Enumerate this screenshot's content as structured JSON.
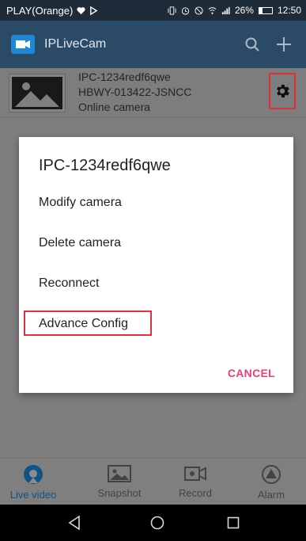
{
  "status_bar": {
    "carrier": "PLAY(Orange)",
    "signal_battery": "26%",
    "battery_level": 0.26,
    "time": "12:50"
  },
  "app_bar": {
    "title": "IPLiveCam",
    "icons": [
      "camera-logo-icon",
      "search-icon",
      "plus-icon"
    ]
  },
  "camera": {
    "name": "IPC-1234redf6qwe",
    "uid": "HBWY-013422-JSNCC",
    "status": "Online camera"
  },
  "dialog": {
    "title": "IPC-1234redf6qwe",
    "items": [
      "Modify camera",
      "Delete camera",
      "Reconnect",
      "Advance Config"
    ],
    "cancel": "CANCEL"
  },
  "bottom_nav": {
    "tabs": [
      {
        "label": "Live video",
        "icon": "live-video-icon",
        "active": true
      },
      {
        "label": "Snapshot",
        "icon": "snapshot-icon",
        "active": false
      },
      {
        "label": "Record",
        "icon": "record-icon",
        "active": false
      },
      {
        "label": "Alarm",
        "icon": "alarm-icon",
        "active": false
      }
    ]
  },
  "system_nav": {
    "icons": [
      "back-icon",
      "home-icon",
      "recents-icon"
    ]
  },
  "colors": {
    "accent": "#e8407a",
    "active_tab": "#2196f3",
    "highlight_box": "#e0303a",
    "app_bar": "#2b4a66"
  }
}
